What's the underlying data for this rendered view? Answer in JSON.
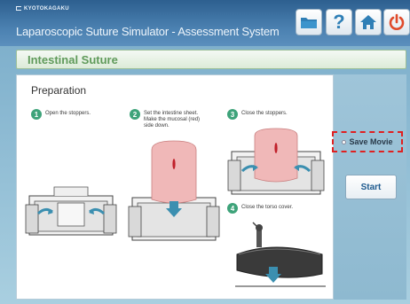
{
  "brand": {
    "name": "KYOTOKAGAKU"
  },
  "app": {
    "title": "Laparoscopic Suture Simulator - Assessment System"
  },
  "toolbar": {
    "folder_icon": "folder-icon",
    "help_icon": "help-icon",
    "home_icon": "home-icon",
    "power_icon": "power-icon",
    "help_label": "?"
  },
  "section": {
    "title": "Intestinal Suture"
  },
  "preparation": {
    "title": "Preparation",
    "steps": [
      {
        "num": "1",
        "text": "Open the stoppers."
      },
      {
        "num": "2",
        "text": "Set the intestine sheet.\nMake the mucosal (red)\nside down."
      },
      {
        "num": "3",
        "text": "Close the stoppers."
      },
      {
        "num": "4",
        "text": "Close the torso cover."
      }
    ]
  },
  "side": {
    "save_movie_label": "Save Movie",
    "start_label": "Start"
  },
  "colors": {
    "step_green": "#3ea37a",
    "title_green": "#5f9a5a",
    "power_red": "#e04a2a",
    "highlight_red": "#e02020",
    "accent_blue": "#1e5a8e"
  }
}
